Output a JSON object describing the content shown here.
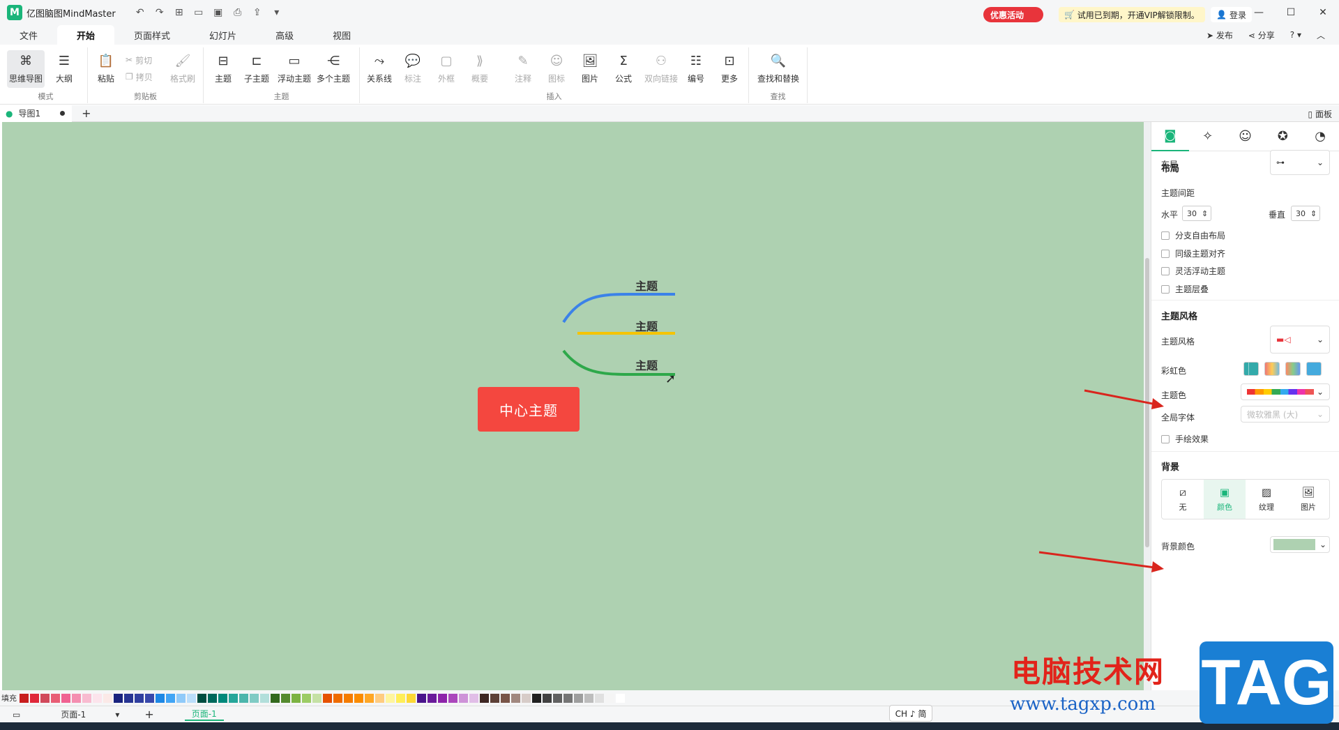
{
  "app": {
    "title": "亿图脑图MindMaster",
    "logo": "M"
  },
  "titlebar": {
    "promo": "优惠活动",
    "vip": "试用已到期，开通VIP解锁限制。",
    "login": "登录",
    "minimize": "—",
    "maximize": "☐",
    "close": "✕"
  },
  "menu": {
    "items": [
      "文件",
      "开始",
      "页面样式",
      "幻灯片",
      "高级",
      "视图"
    ],
    "publish": "发布",
    "share": "分享",
    "help": "?"
  },
  "ribbon": {
    "mode": {
      "label": "模式",
      "mindmap": "思维导图",
      "outline": "大纲"
    },
    "clipboard": {
      "label": "剪贴板",
      "paste": "粘贴",
      "cut": "剪切",
      "copy": "拷贝",
      "format_painter": "格式刷"
    },
    "topic": {
      "label": "主题",
      "topic": "主题",
      "subtopic": "子主题",
      "floating": "浮动主题",
      "multi": "多个主题"
    },
    "insert": {
      "label": "插入",
      "relationship": "关系线",
      "callout": "标注",
      "boundary": "外框",
      "summary": "概要",
      "note": "注释",
      "icon": "图标",
      "picture": "图片",
      "formula": "公式",
      "bilink": "双向链接",
      "numbering": "编号",
      "more": "更多"
    },
    "find": {
      "label": "查找",
      "find_replace": "查找和替换"
    }
  },
  "doctabs": {
    "tab": "导图1",
    "panel": "面板"
  },
  "canvas": {
    "central": "中心主题",
    "topics": [
      "主题",
      "主题",
      "主题"
    ],
    "background": "#aed1b1",
    "branch_colors": [
      "#3b82e8",
      "#f5c400",
      "#2ea84a"
    ],
    "central_color": "#f4473f"
  },
  "panel": {
    "layout_section": "布局",
    "layout_label": "布局",
    "spacing_label": "主题间距",
    "horizontal_label": "水平",
    "horizontal_value": "30",
    "vertical_label": "垂直",
    "vertical_value": "30",
    "checks": [
      "分支自由布局",
      "同级主题对齐",
      "灵活浮动主题",
      "主题层叠"
    ],
    "style_section": "主题风格",
    "style_label": "主题风格",
    "rainbow_label": "彩虹色",
    "theme_color_label": "主题色",
    "font_label": "全局字体",
    "font_value": "微软雅黑 (大)",
    "hand_drawn": "手绘效果",
    "bg_section": "背景",
    "bg_options": [
      "无",
      "颜色",
      "纹理",
      "图片"
    ],
    "bg_color_label": "背景颜色"
  },
  "palette": {
    "fill_label": "填充"
  },
  "statusbar": {
    "page_select": "页面-1",
    "page_tab": "页面-1",
    "add": "+"
  },
  "ime": "CH ♪ 简",
  "watermark": {
    "text": "电脑技术网",
    "url": "www.tagxp.com",
    "tag": "TAG"
  }
}
